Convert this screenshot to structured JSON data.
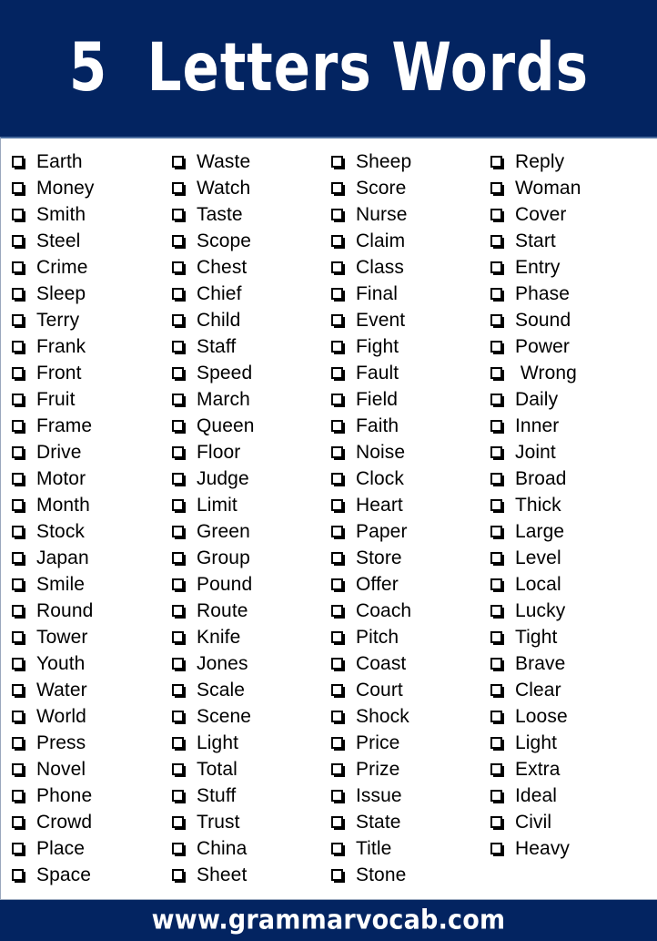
{
  "header": {
    "title": "5  Letters Words",
    "background_color": "#032461",
    "text_color": "#ffffff"
  },
  "content": {
    "checkbox_icon": "shadowed-square-checkbox",
    "columns": [
      {
        "index": 1,
        "items": [
          "Earth",
          "Money",
          "Smith",
          "Steel",
          "Crime",
          "Sleep",
          "Terry",
          "Frank",
          "Front",
          "Fruit",
          "Frame",
          "Drive",
          "Motor",
          "Month",
          "Stock",
          "Japan",
          "Smile",
          "Round",
          "Tower",
          "Youth",
          "Water",
          "World",
          "Press",
          "Novel",
          "Phone",
          "Crowd",
          "Place",
          "Space"
        ]
      },
      {
        "index": 2,
        "items": [
          "Waste",
          "Watch",
          "Taste",
          "Scope",
          "Chest",
          "Chief",
          "Child",
          "Staff",
          "Speed",
          "March",
          "Queen",
          "Floor",
          "Judge",
          "Limit",
          "Green",
          "Group",
          "Pound",
          "Route",
          "Knife",
          "Jones",
          "Scale",
          "Scene",
          "Light",
          "Total",
          "Stuff",
          "Trust",
          "China",
          "Sheet"
        ]
      },
      {
        "index": 3,
        "items": [
          "Sheep",
          "Score",
          "Nurse",
          "Claim",
          "Class",
          "Final",
          "Event",
          "Fight",
          "Fault",
          "Field",
          "Faith",
          "Noise",
          "Clock",
          "Heart",
          "Paper",
          "Store",
          "Offer",
          "Coach",
          "Pitch",
          "Coast",
          "Court",
          "Shock",
          "Price",
          "Prize",
          "Issue",
          "State",
          "Title",
          "Stone"
        ]
      },
      {
        "index": 4,
        "items": [
          "Reply",
          "Woman",
          "Cover",
          "Start",
          "Entry",
          "Phase",
          "Sound",
          "Power",
          " Wrong",
          "Daily",
          "Inner",
          "Joint",
          "Broad",
          "Thick",
          "Large",
          "Level",
          "Local",
          "Lucky",
          "Tight",
          "Brave",
          "Clear",
          "Loose",
          "Light",
          "Extra",
          "Ideal",
          "Civil",
          "Heavy"
        ]
      }
    ]
  },
  "footer": {
    "website": "www.grammarvocab.com",
    "background_color": "#032461",
    "text_color": "#ffffff"
  }
}
